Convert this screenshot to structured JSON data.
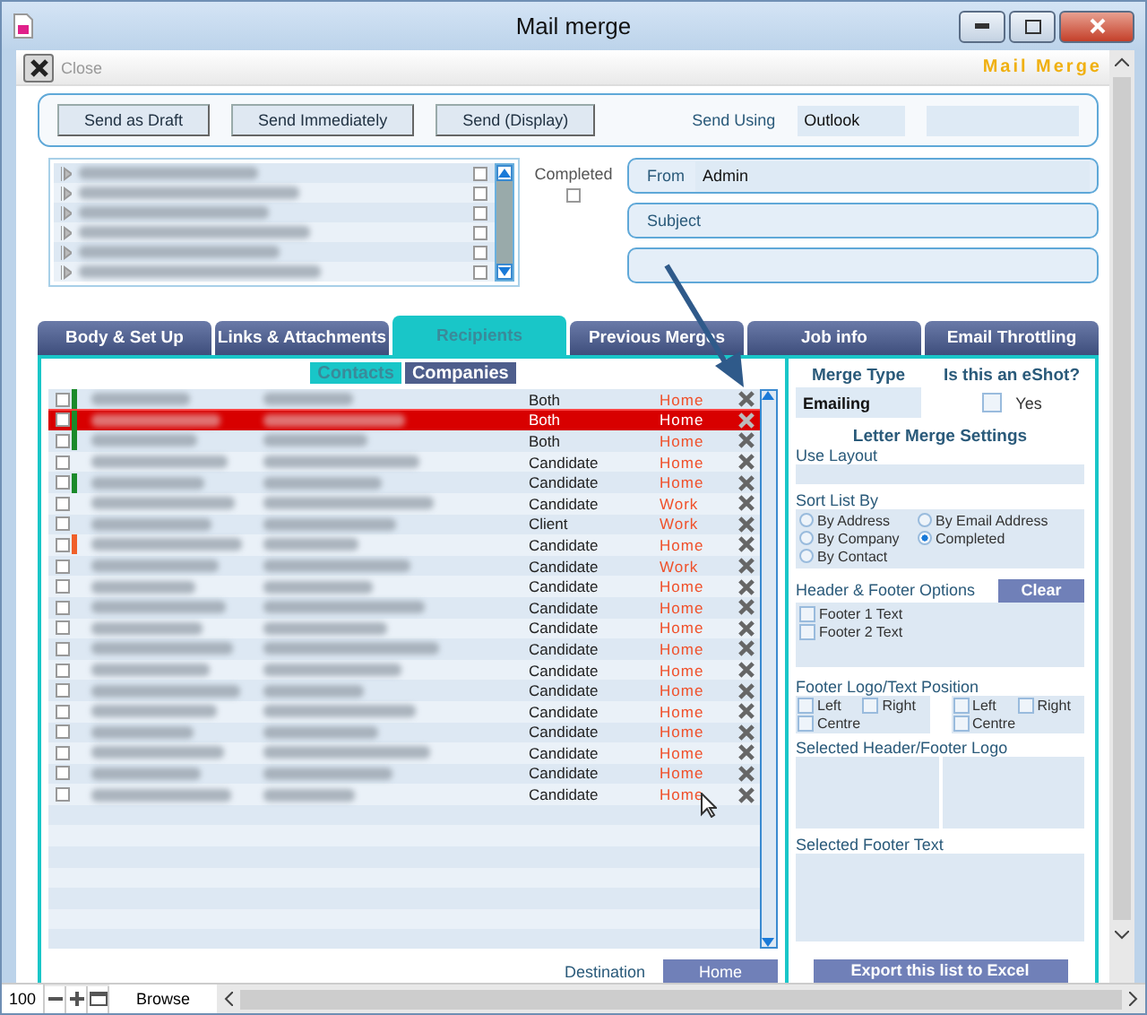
{
  "window": {
    "title": "Mail merge"
  },
  "toolbar": {
    "close": "Close",
    "brand": "Mail Merge"
  },
  "send_buttons": [
    "Send as Draft",
    "Send Immediately",
    "Send (Display)"
  ],
  "send_using": {
    "label": "Send Using",
    "value": "Outlook"
  },
  "attachments": [
    {
      "checked": false
    },
    {
      "checked": false
    },
    {
      "checked": false
    },
    {
      "checked": false
    },
    {
      "checked": false
    },
    {
      "checked": false
    }
  ],
  "completed": {
    "label": "Completed",
    "checked": false
  },
  "from": {
    "label": "From",
    "value": "Admin"
  },
  "subject": {
    "label": "Subject"
  },
  "tabs": [
    {
      "label": "Body & Set Up",
      "selected": false
    },
    {
      "label": "Links & Attachments",
      "selected": false
    },
    {
      "label": "Recipients",
      "selected": true
    },
    {
      "label": "Previous Merges",
      "selected": false
    },
    {
      "label": "Job info",
      "selected": false
    },
    {
      "label": "Email Throttling",
      "selected": false
    }
  ],
  "subtabs": [
    {
      "label": "Contacts",
      "selected": true
    },
    {
      "label": "Companies",
      "selected": false
    }
  ],
  "recipients": [
    {
      "type": "Both",
      "address": "Home",
      "selected": false,
      "checked": false,
      "color": "#1a8a2a"
    },
    {
      "type": "Both",
      "address": "Home",
      "selected": true,
      "checked": false,
      "color": "#1a8a2a"
    },
    {
      "type": "Both",
      "address": "Home",
      "selected": false,
      "checked": false,
      "color": "#1a8a2a"
    },
    {
      "type": "Candidate",
      "address": "Home",
      "selected": false,
      "checked": false
    },
    {
      "type": "Candidate",
      "address": "Home",
      "selected": false,
      "checked": false,
      "color": "#1a8a2a"
    },
    {
      "type": "Candidate",
      "address": "Work",
      "selected": false,
      "checked": false
    },
    {
      "type": "Client",
      "address": "Work",
      "selected": false,
      "checked": false
    },
    {
      "type": "Candidate",
      "address": "Home",
      "selected": false,
      "checked": false,
      "color": "#f0602a"
    },
    {
      "type": "Candidate",
      "address": "Work",
      "selected": false,
      "checked": false
    },
    {
      "type": "Candidate",
      "address": "Home",
      "selected": false,
      "checked": false
    },
    {
      "type": "Candidate",
      "address": "Home",
      "selected": false,
      "checked": false
    },
    {
      "type": "Candidate",
      "address": "Home",
      "selected": false,
      "checked": false
    },
    {
      "type": "Candidate",
      "address": "Home",
      "selected": false,
      "checked": false
    },
    {
      "type": "Candidate",
      "address": "Home",
      "selected": false,
      "checked": false
    },
    {
      "type": "Candidate",
      "address": "Home",
      "selected": false,
      "checked": false
    },
    {
      "type": "Candidate",
      "address": "Home",
      "selected": false,
      "checked": false
    },
    {
      "type": "Candidate",
      "address": "Home",
      "selected": false,
      "checked": false
    },
    {
      "type": "Candidate",
      "address": "Home",
      "selected": false,
      "checked": false
    },
    {
      "type": "Candidate",
      "address": "Home",
      "selected": false,
      "checked": false
    },
    {
      "type": "Candidate",
      "address": "Home",
      "selected": false,
      "checked": false
    }
  ],
  "destination": {
    "label": "Destination",
    "value": "Home"
  },
  "merge_type": {
    "label": "Merge Type",
    "value": "Emailing"
  },
  "eshot": {
    "label": "Is this an eShot?",
    "option": "Yes",
    "checked": false
  },
  "letter_settings": {
    "title": "Letter Merge Settings",
    "use_layout": "Use Layout",
    "sort_label": "Sort List By",
    "sort_options": [
      {
        "label": "By Address",
        "selected": false
      },
      {
        "label": "By Email Address",
        "selected": false
      },
      {
        "label": "By Company",
        "selected": false
      },
      {
        "label": "Completed",
        "selected": true
      },
      {
        "label": "By Contact",
        "selected": false
      }
    ],
    "hf_label": "Header & Footer Options",
    "clear": "Clear",
    "hf_options": [
      {
        "label": "Footer 1 Text",
        "checked": false
      },
      {
        "label": "Footer 2 Text",
        "checked": false
      }
    ],
    "position_label": "Footer Logo/Text Position",
    "position_groups": [
      [
        {
          "label": "Left",
          "checked": false
        },
        {
          "label": "Right",
          "checked": false
        },
        {
          "label": "Centre",
          "checked": false
        }
      ],
      [
        {
          "label": "Left",
          "checked": false
        },
        {
          "label": "Right",
          "checked": false
        },
        {
          "label": "Centre",
          "checked": false
        }
      ]
    ],
    "logo_label": "Selected Header/Footer Logo",
    "footer_text_label": "Selected Footer Text"
  },
  "export": "Export this list to Excel",
  "status_bar": {
    "zoom": "100",
    "mode": "Browse"
  }
}
